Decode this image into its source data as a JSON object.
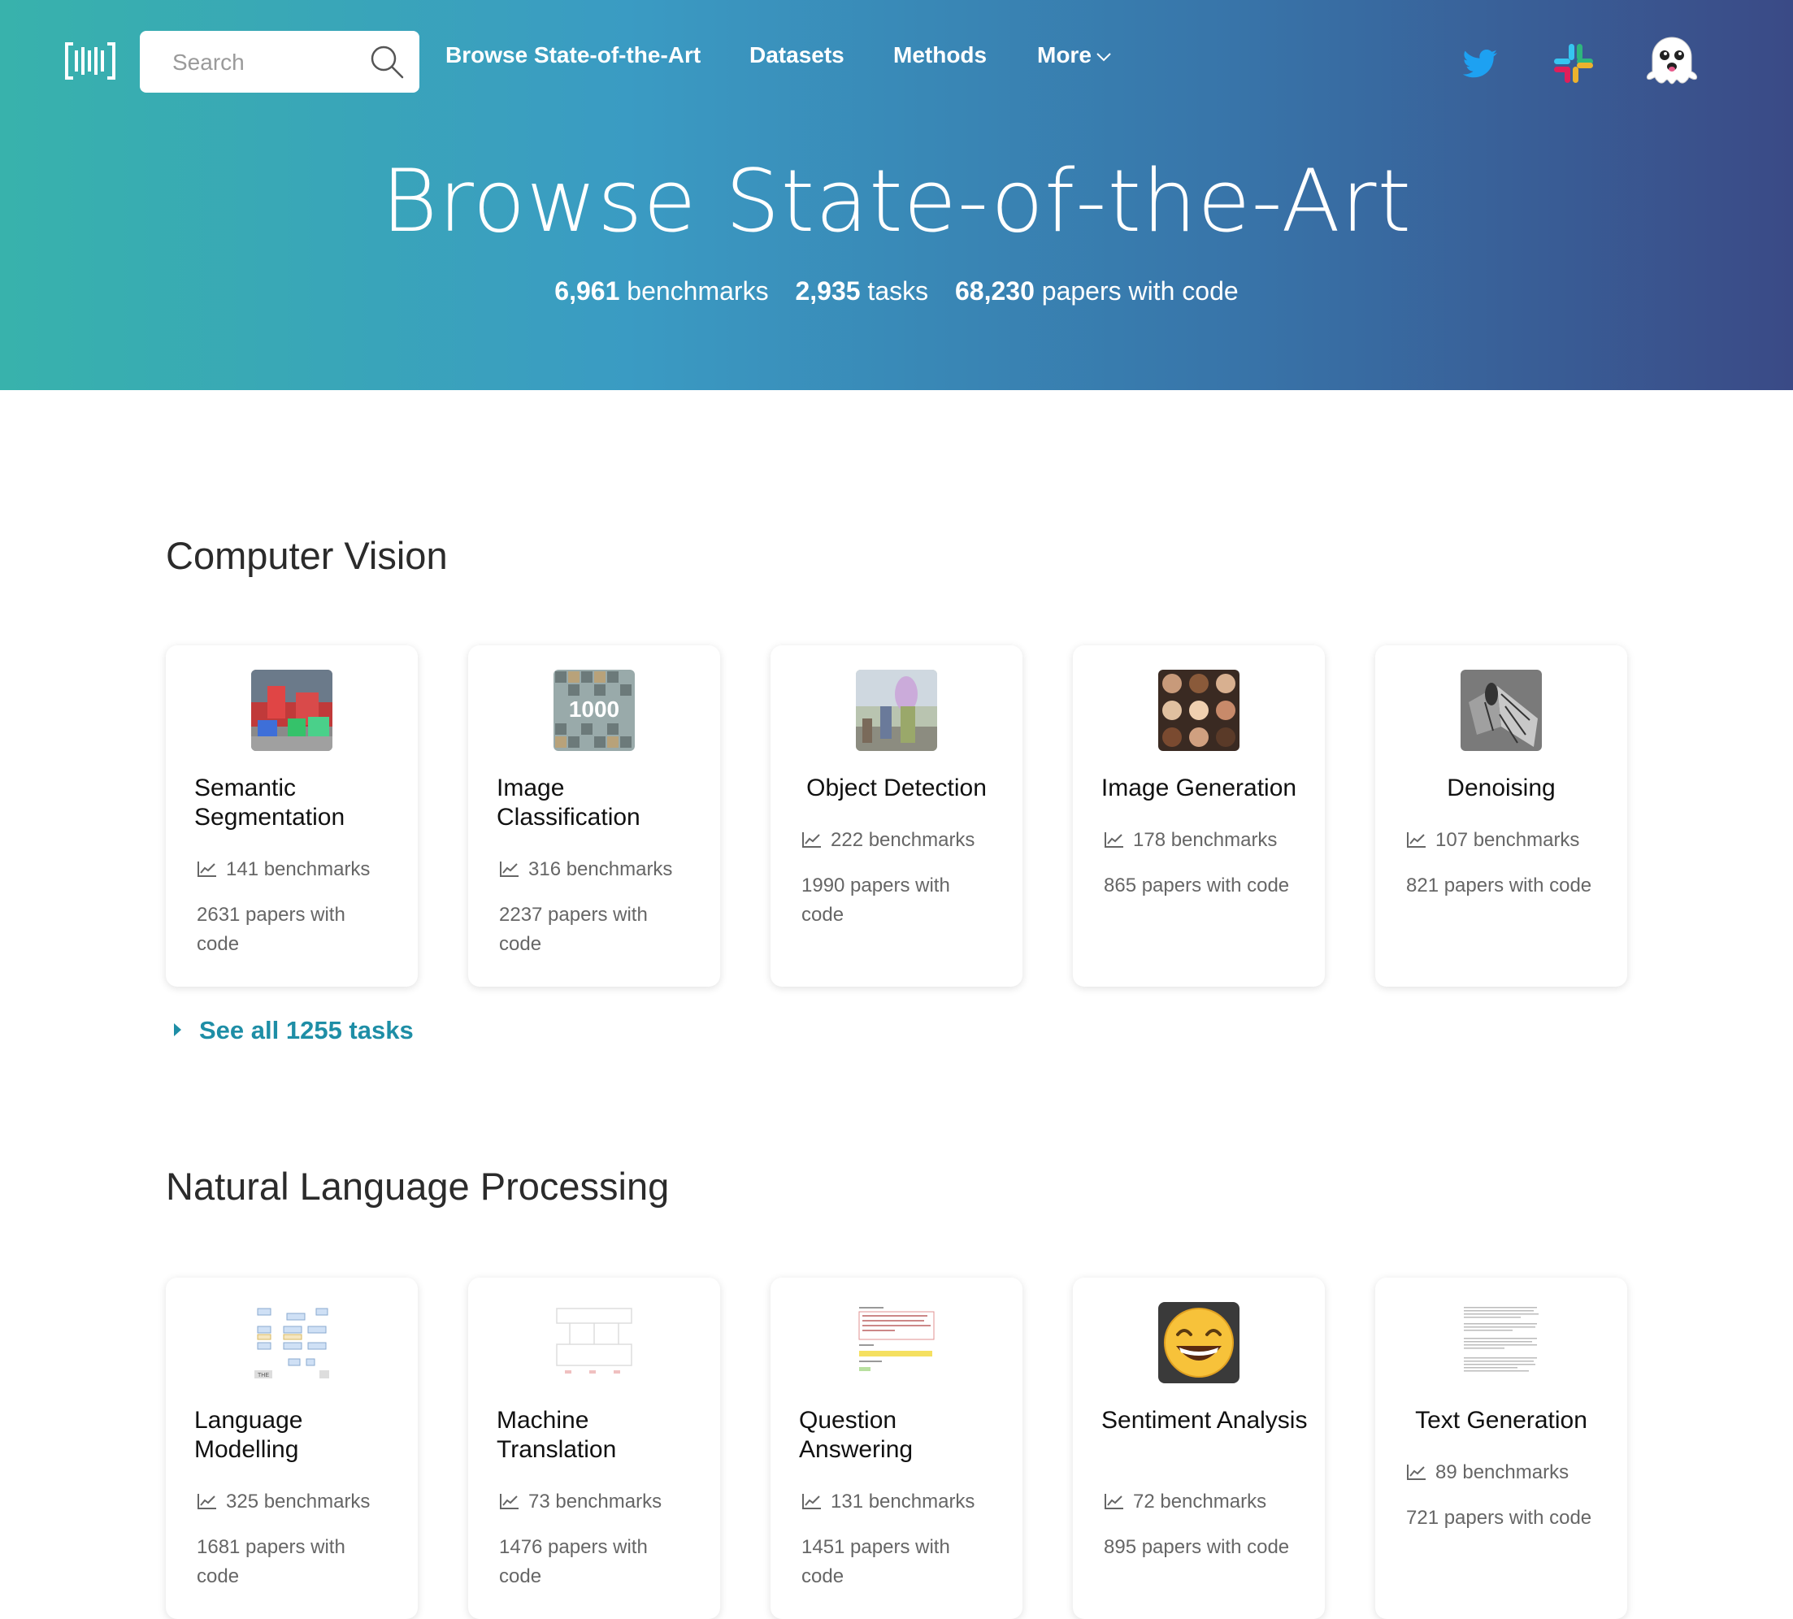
{
  "header": {
    "search_placeholder": "Search",
    "nav": {
      "browse": "Browse State-of-the-Art",
      "datasets": "Datasets",
      "methods": "Methods",
      "more": "More"
    }
  },
  "hero": {
    "title": "Browse State-of-the-Art",
    "stats": [
      {
        "value": "6,961",
        "label": "benchmarks"
      },
      {
        "value": "2,935",
        "label": "tasks"
      },
      {
        "value": "68,230",
        "label": "papers with code"
      }
    ]
  },
  "sections": [
    {
      "title": "Computer Vision",
      "see_all": "See all 1255 tasks",
      "cards": [
        {
          "title": "Semantic Segmentation",
          "benchmarks": "141 benchmarks",
          "papers": "2631 papers with code"
        },
        {
          "title": "Image Classification",
          "benchmarks": "316 benchmarks",
          "papers": "2237 papers with code"
        },
        {
          "title": "Object Detection",
          "benchmarks": "222 benchmarks",
          "papers": "1990 papers with code"
        },
        {
          "title": "Image Generation",
          "benchmarks": "178 benchmarks",
          "papers": "865 papers with code"
        },
        {
          "title": "Denoising",
          "benchmarks": "107 benchmarks",
          "papers": "821 papers with code"
        }
      ]
    },
    {
      "title": "Natural Language Processing",
      "cards": [
        {
          "title": "Language Modelling",
          "benchmarks": "325 benchmarks",
          "papers": "1681 papers with code"
        },
        {
          "title": "Machine Translation",
          "benchmarks": "73 benchmarks",
          "papers": "1476 papers with code"
        },
        {
          "title": "Question Answering",
          "benchmarks": "131 benchmarks",
          "papers": "1451 papers with code"
        },
        {
          "title": "Sentiment Analysis",
          "benchmarks": "72 benchmarks",
          "papers": "895 papers with code"
        },
        {
          "title": "Text Generation",
          "benchmarks": "89 benchmarks",
          "papers": "721 papers with code"
        }
      ]
    }
  ],
  "colors": {
    "accent": "#1e8ea6",
    "gradient_start": "#38b2ac",
    "gradient_end": "#3a4a86"
  }
}
